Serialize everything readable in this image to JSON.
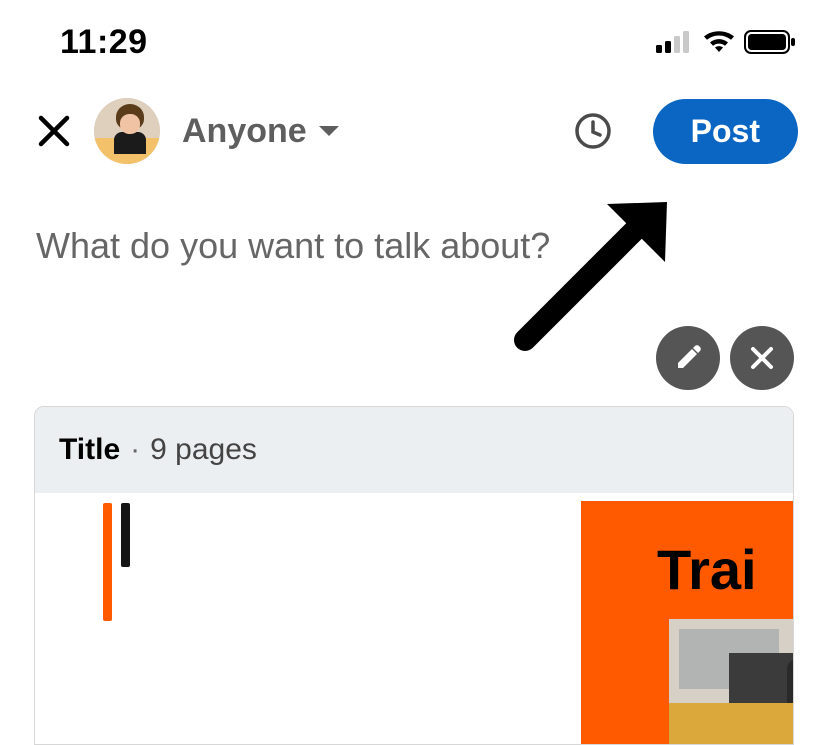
{
  "status_bar": {
    "time": "11:29"
  },
  "composer": {
    "audience_label": "Anyone",
    "post_button": "Post",
    "placeholder": "What do you want to talk about?"
  },
  "attachment": {
    "title_label": "Title",
    "separator": "·",
    "pages_label": "9 pages",
    "slide_preview_heading": "Trai"
  },
  "icons": {
    "close": "close-icon",
    "caret": "chevron-down-icon",
    "clock": "clock-icon",
    "pencil": "pencil-icon",
    "remove": "close-icon",
    "signal": "cellular-signal-icon",
    "wifi": "wifi-icon",
    "battery": "battery-icon"
  },
  "colors": {
    "primary": "#0a66c2",
    "accent": "#ff5a00",
    "dark_btn": "#555555"
  }
}
